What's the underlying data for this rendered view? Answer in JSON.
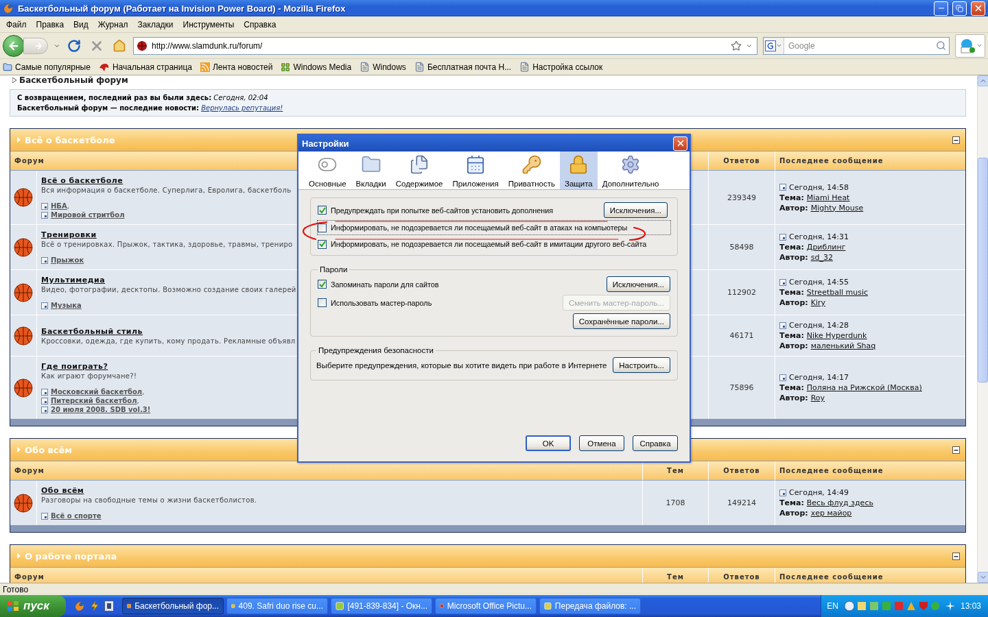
{
  "browser": {
    "title": "Баскетбольный форум (Работает на Invision Power Board) - Mozilla Firefox",
    "menu": [
      "Файл",
      "Правка",
      "Вид",
      "Журнал",
      "Закладки",
      "Инструменты",
      "Справка"
    ],
    "url": "http://www.slamdunk.ru/forum/",
    "search_placeholder": "Google",
    "bookmarks": [
      {
        "label": "Самые популярные",
        "kind": "smart"
      },
      {
        "label": "Начальная страница",
        "kind": "site"
      },
      {
        "label": "Лента новостей",
        "kind": "feed"
      },
      {
        "label": "Windows Media",
        "kind": "windows"
      },
      {
        "label": "Windows",
        "kind": "page"
      },
      {
        "label": "Бесплатная почта H...",
        "kind": "page"
      },
      {
        "label": "Настройка ссылок",
        "kind": "page"
      }
    ],
    "status": "Готово"
  },
  "page": {
    "breadcrumb": "Баскетбольный форум",
    "welcome": "**С возвращением, последний раз вы были здесь:** *Сегодня, 02:04*",
    "news": {
      "text": "Баскетбольный форум — последние новости:",
      "link": "Вернулась репутация!"
    }
  },
  "categories": [
    {
      "title": "Всё о баскетболе",
      "columns": {
        "forum": "Форум",
        "replies": "Ответов",
        "last_post": "Последнее сообщение"
      },
      "forums": [
        {
          "name": "Всё о баскетболе",
          "description": "Вся информация о баскетболе. Суперлига, Евролига, баскетболь",
          "subforums": [
            {
              "name": "НБА",
              "separator": ","
            },
            {
              "name": "Мировой стритбол"
            }
          ],
          "replies": "239349",
          "last": {
            "date": "Сегодня, 14:58",
            "topic_label": "Тема:",
            "topic": "Miami Heat",
            "author_label": "Автор:",
            "author": "Mighty Mouse"
          }
        },
        {
          "name": "Тренировки",
          "description": "Всё о тренировках. Прыжок, тактика, здоровье, травмы, трениро",
          "subforums": [
            {
              "name": "Прыжок"
            }
          ],
          "replies": "58498",
          "last": {
            "date": "Сегодня, 14:31",
            "topic_label": "Тема:",
            "topic": "Дриблинг",
            "author_label": "Автор:",
            "author": "sd_32"
          }
        },
        {
          "name": "Мультимедиа",
          "description": "Видео, фотографии, десктопы. Возможно создание своих галерей",
          "subforums": [
            {
              "name": "Музыка"
            }
          ],
          "replies": "112902",
          "last": {
            "date": "Сегодня, 14:55",
            "topic_label": "Тема:",
            "topic": "Streetball music",
            "author_label": "Автор:",
            "author": "Kiry"
          }
        },
        {
          "name": "Баскетбольный стиль",
          "description": "Кроссовки, одежда, где купить, кому продать. Рекламные объявл",
          "replies": "46171",
          "last": {
            "date": "Сегодня, 14:28",
            "topic_label": "Тема:",
            "topic": "Nike Hyperdunk",
            "author_label": "Автор:",
            "author": "маленький Shaq"
          }
        },
        {
          "name": "Где поиграть?",
          "description": "Как играют форумчане?!",
          "subforums": [
            {
              "name": "Московский баскетбол",
              "separator": ","
            },
            {
              "name": "Питерский баскетбол",
              "separator": ","
            },
            {
              "name": "20 июля 2008. SDB vol.3!"
            }
          ],
          "replies": "75896",
          "last": {
            "date": "Сегодня, 14:17",
            "topic_label": "Тема:",
            "topic": "Поляна на Рижской (Москва)",
            "author_label": "Автор:",
            "author": "Roy"
          }
        }
      ]
    },
    {
      "title": "Обо всём",
      "columns": {
        "forum": "Форум",
        "topics": "Тем",
        "replies": "Ответов",
        "last_post": "Последнее сообщение"
      },
      "forums": [
        {
          "name": "Обо всём",
          "description": "Разговоры на свободные темы о жизни баскетболистов.",
          "subforums": [
            {
              "name": "Всё о спорте"
            }
          ],
          "topics": "1708",
          "replies": "149214",
          "last": {
            "date": "Сегодня, 14:49",
            "topic_label": "Тема:",
            "topic": "Весь флуд здесь",
            "author_label": "Автор:",
            "author": "хер майор"
          }
        }
      ]
    },
    {
      "title": "О работе портала",
      "columns": {
        "forum": "Форум",
        "topics": "Тем",
        "replies": "Ответов",
        "last_post": "Последнее сообщение"
      }
    }
  ],
  "dialog": {
    "title": "Настройки",
    "tabs": [
      {
        "label": "Основные",
        "selected": false
      },
      {
        "label": "Вкладки",
        "selected": false
      },
      {
        "label": "Содержимое",
        "selected": false
      },
      {
        "label": "Приложения",
        "selected": false
      },
      {
        "label": "Приватность",
        "selected": false
      },
      {
        "label": "Защита",
        "selected": true
      },
      {
        "label": "Дополнительно",
        "selected": false
      }
    ],
    "general": {
      "options": [
        {
          "label": "Предупреждать при попытке веб-сайтов установить дополнения",
          "checked": true,
          "focused": false
        },
        {
          "label": "Информировать, не подозревается ли посещаемый веб-сайт в атаках на компьютеры",
          "checked": false,
          "focused": true
        },
        {
          "label": "Информировать, не подозревается ли посещаемый веб-сайт в имитации другого веб-сайта",
          "checked": true,
          "focused": false
        }
      ],
      "button": "Исключения..."
    },
    "passwords": {
      "legend": "Пароли",
      "options": [
        {
          "label": "Запоминать пароли для сайтов",
          "checked": true
        },
        {
          "label": "Использовать мастер-пароль",
          "checked": false
        }
      ],
      "buttons": [
        {
          "label": "Исключения...",
          "disabled": false
        },
        {
          "label": "Сменить мастер-пароль...",
          "disabled": true
        },
        {
          "label": "Сохранённые пароли...",
          "disabled": false
        }
      ]
    },
    "warnings": {
      "legend": "Предупреждения безопасности",
      "text": "Выберите предупреждения, которые вы хотите видеть при работе в Интернете",
      "button": "Настроить..."
    },
    "footer": [
      {
        "label": "OK",
        "default": true
      },
      {
        "label": "Отмена",
        "default": false
      },
      {
        "label": "Справка",
        "default": false
      }
    ]
  },
  "taskbar": {
    "start": "пуск",
    "tasks": [
      {
        "label": "Баскетбольный фор...",
        "active": true
      },
      {
        "label": "409. Safri duo rise cu...",
        "active": false
      },
      {
        "label": "[491-839-834] - Окн...",
        "active": false
      },
      {
        "label": "Microsoft Office Pictu...",
        "active": false
      },
      {
        "label": "Передача файлов: ...",
        "active": false
      }
    ],
    "language": "EN",
    "clock": "13:03"
  }
}
